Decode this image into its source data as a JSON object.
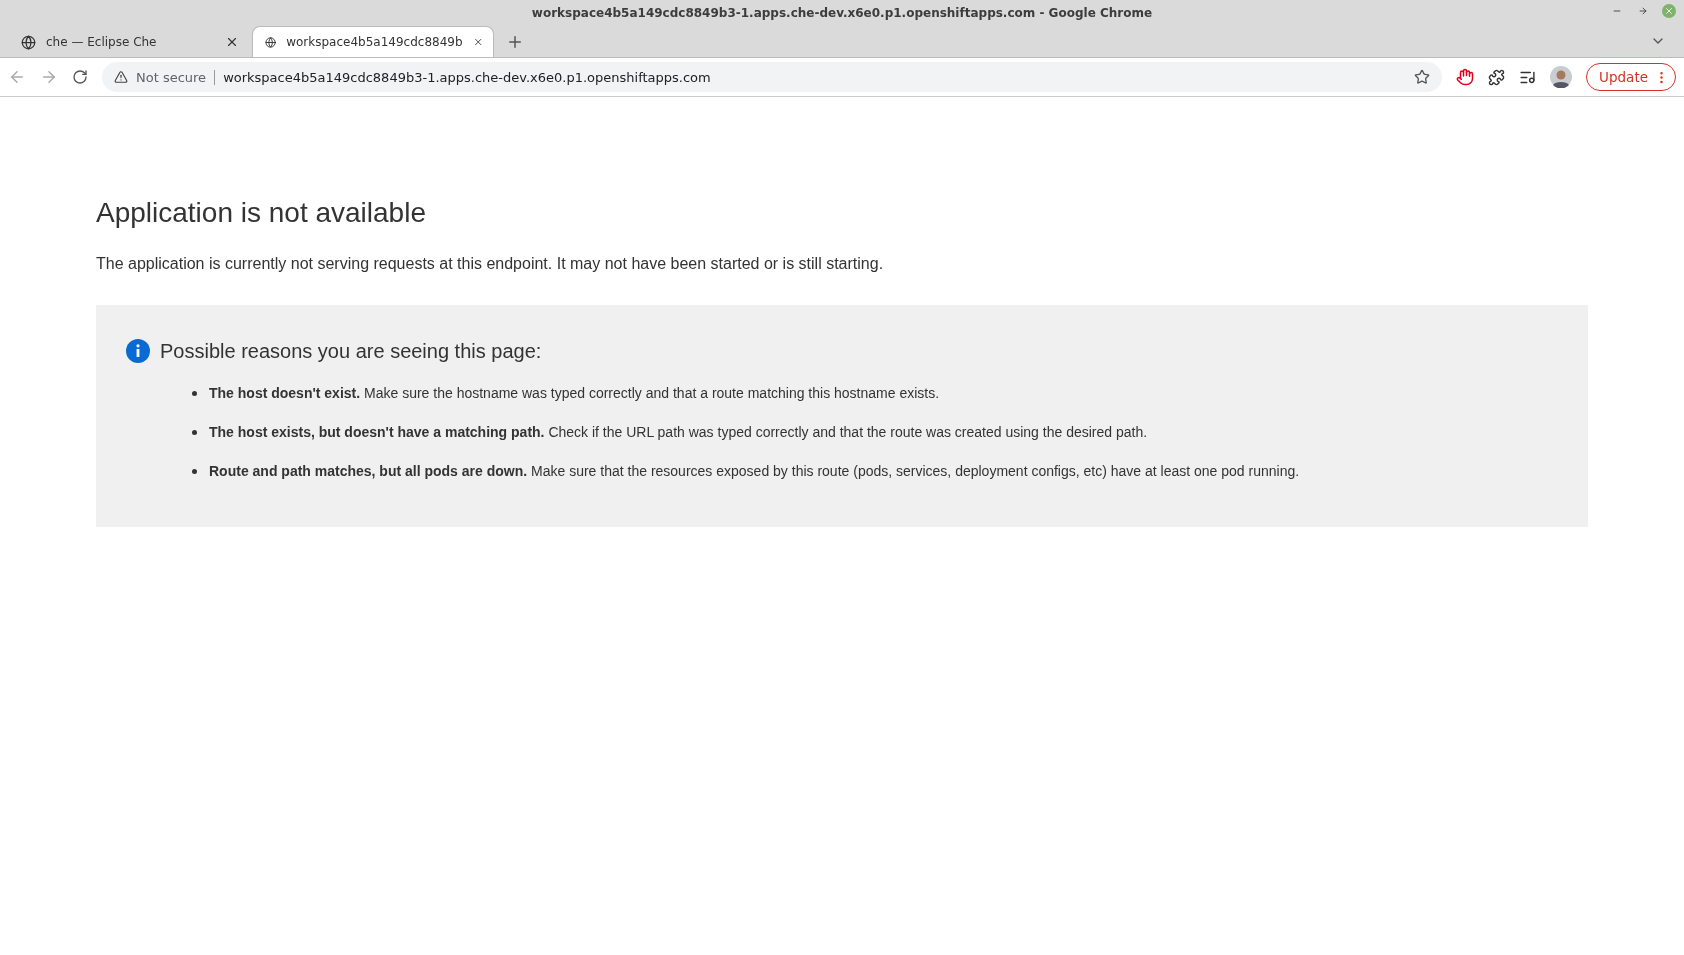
{
  "window": {
    "title": "workspace4b5a149cdc8849b3-1.apps.che-dev.x6e0.p1.openshiftapps.com - Google Chrome"
  },
  "tabs": [
    {
      "label": "che — Eclipse Che",
      "selected": false
    },
    {
      "label": "workspace4b5a149cdc8849b",
      "selected": true
    }
  ],
  "address_bar": {
    "security": "Not secure",
    "url": "workspace4b5a149cdc8849b3-1.apps.che-dev.x6e0.p1.openshiftapps.com"
  },
  "update_button": "Update",
  "page": {
    "heading": "Application is not available",
    "message": "The application is currently not serving requests at this endpoint. It may not have been started or is still starting.",
    "reasons": {
      "title": "Possible reasons you are seeing this page:",
      "items": [
        "**The host doesn't exist.** Make sure the hostname was typed correctly and that a route matching this hostname exists.",
        "**The host exists, but doesn't have a matching path.** Check if the URL path was typed correctly and that the route was created using the desired path.",
        "**Route and path matches, but all pods are down.** Make sure that the resources exposed by this route (pods, services, deployment configs, etc) have at least one pod running."
      ]
    }
  }
}
